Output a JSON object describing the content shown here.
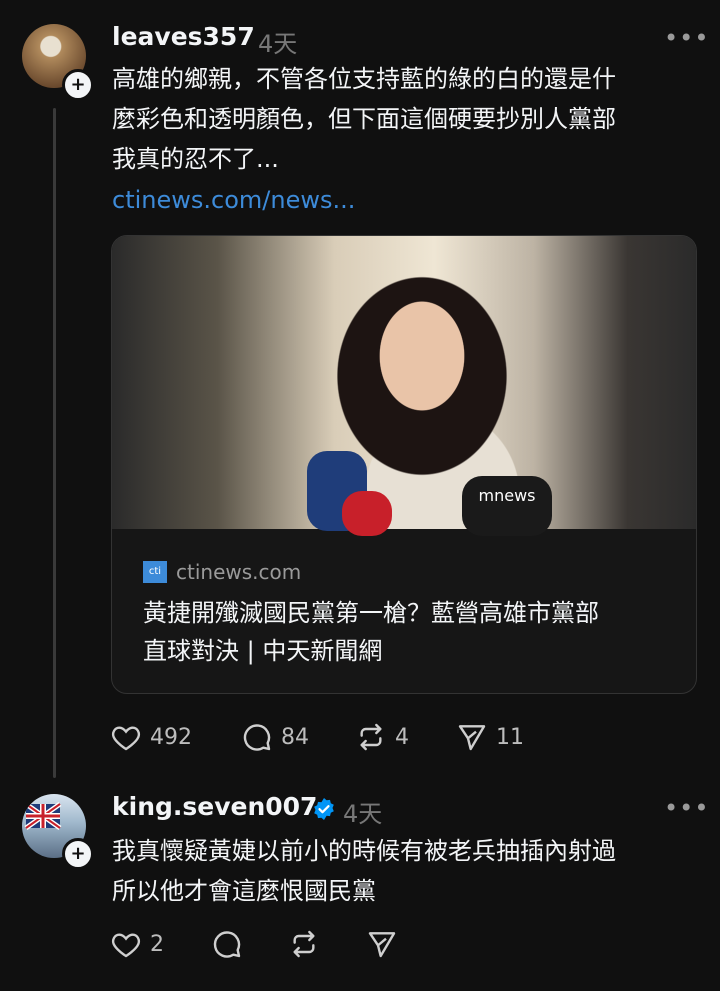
{
  "posts": [
    {
      "username": "leaves357",
      "time": "4天",
      "more": "•••",
      "text_lines": [
        "高雄的鄉親，不管各位支持藍的綠的白的還是什",
        "麼彩色和透明顏色，但下面這個硬要抄別人黨部",
        "我真的忍不了..."
      ],
      "link": "ctinews.com/news...",
      "card": {
        "source_icon": "cti",
        "domain": "ctinews.com",
        "title_lines": [
          "黃捷開殲滅國民黨第一槍？藍營高雄市黨部",
          "直球對決 | 中天新聞網"
        ],
        "mic_labels": [
          "mnews"
        ]
      },
      "actions": {
        "likes": "492",
        "comments": "84",
        "reposts": "4",
        "shares": "11"
      }
    },
    {
      "username": "king.seven007",
      "verified": true,
      "time": "4天",
      "more": "•••",
      "text_lines": [
        "我真懷疑黃婕以前小的時候有被老兵抽插內射過",
        "所以他才會這麼恨國民黨"
      ],
      "actions": {
        "likes": "2"
      }
    }
  ],
  "colors": {
    "background": "#101010",
    "link": "#3d8bd9",
    "verified": "#0095f6",
    "muted": "#777777"
  }
}
